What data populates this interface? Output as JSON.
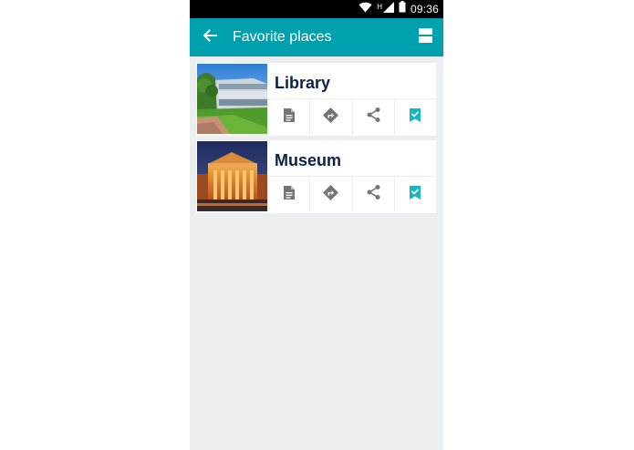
{
  "status_bar": {
    "time": "09:36",
    "network_type": "H",
    "icons": [
      "wifi-icon",
      "signal-icon",
      "battery-icon"
    ]
  },
  "toolbar": {
    "title": "Favorite places",
    "back_icon": "arrow-left-icon",
    "view_icon": "view-agenda-icon",
    "background_color": "#00a1af"
  },
  "places": [
    {
      "title": "Library",
      "image": "library-photo",
      "actions": [
        "details-icon",
        "directions-icon",
        "share-icon",
        "bookmark-check-icon"
      ]
    },
    {
      "title": "Museum",
      "image": "museum-photo",
      "actions": [
        "details-icon",
        "directions-icon",
        "share-icon",
        "bookmark-check-icon"
      ]
    }
  ],
  "colors": {
    "accent": "#00a1af",
    "bookmark": "#1ab5c5",
    "title_text": "#0d2048",
    "icon_gray": "#757575",
    "background": "#ebefef"
  }
}
